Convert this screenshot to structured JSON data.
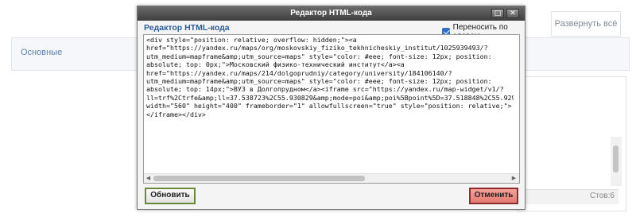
{
  "background": {
    "expand_all_label": "Развернуть всё",
    "section_label": "Основные",
    "line_counter": "Стов:6"
  },
  "dialog": {
    "title": "Редактор HTML-кода",
    "heading": "Редактор HTML-кода",
    "wrap_words_label": "Переносить по словам",
    "wrap_words_checked": true,
    "code": "<div style=\"position: relative; overflow: hidden;\"><a\nhref=\"https://yandex.ru/maps/org/moskovskiy_fiziko_tekhnicheskiy_institut/1025939493/?\nutm_medium=mapframe&amp;utm_source=maps\" style=\"color: #eee; font-size: 12px; position:\nabsolute; top: 0px;\">Московский физико-технический институт</a><a\nhref=\"https://yandex.ru/maps/214/dolgoprudniy/category/university/184106140/?\nutm_medium=mapframe&amp;utm_source=maps\" style=\"color: #eee; font-size: 12px; position:\nabsolute; top: 14px;\">ВУЗ в Долгопрудном</a><iframe src=\"https://yandex.ru/map-widget/v1/?\nll=trf%2Ctrfe&amp;ll=37.538723%2C55.930829&amp;mode=poi&amp;poi%5Bpoint%5D=37.518848%2C55.929532&a\nwidth=\"560\" height=\"400\" frameborder=\"1\" allowfullscreen=\"true\" style=\"position: relative;\">\n</iframe></div>",
    "refresh_label": "Обновить",
    "cancel_label": "Отменить",
    "maximize_glyph": "□",
    "close_glyph": "✕"
  },
  "colors": {
    "heading": "#2a5d9a",
    "refresh_border": "#6a8a3a",
    "cancel_bg": "#e57a70"
  }
}
